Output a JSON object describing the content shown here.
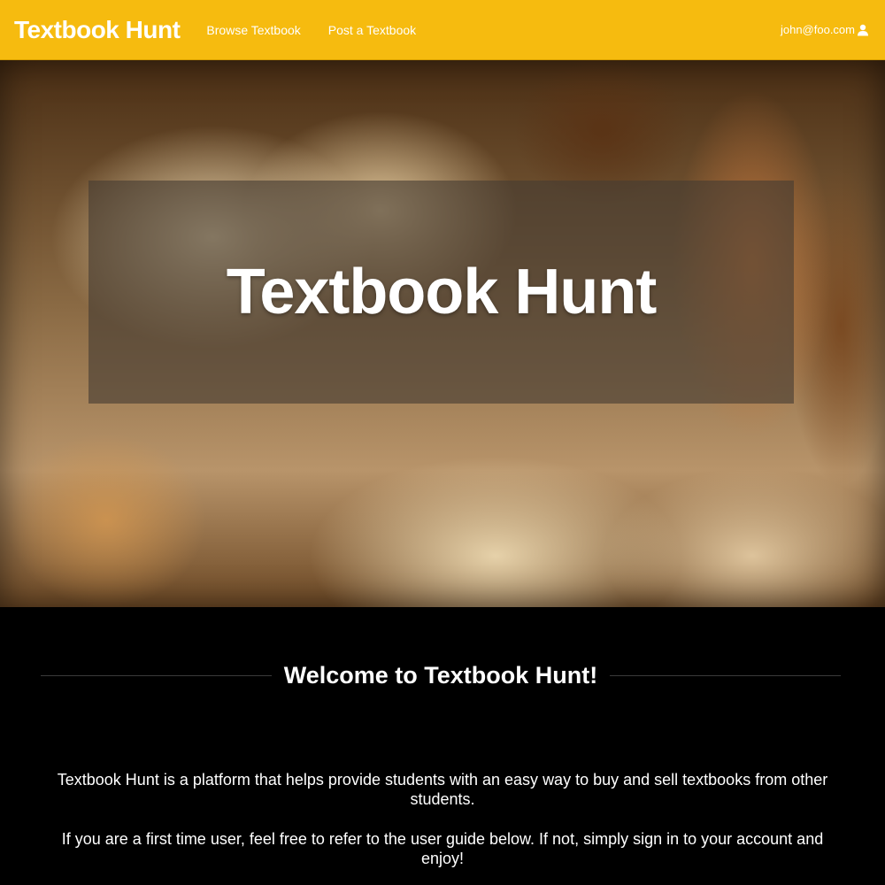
{
  "navbar": {
    "brand": "Textbook Hunt",
    "links": [
      "Browse Textbook",
      "Post a Textbook"
    ],
    "user_email": "john@foo.com",
    "user_icon": "user-icon",
    "background_color": "#f6bb0f"
  },
  "hero": {
    "title": "Textbook Hunt"
  },
  "welcome": {
    "heading": "Welcome to Textbook Hunt!",
    "paragraphs": [
      "Textbook Hunt is a platform that helps provide students with an easy way to buy and sell textbooks from other students.",
      "If you are a first time user, feel free to refer to the user guide below. If not, simply sign in to your account and enjoy!"
    ]
  }
}
